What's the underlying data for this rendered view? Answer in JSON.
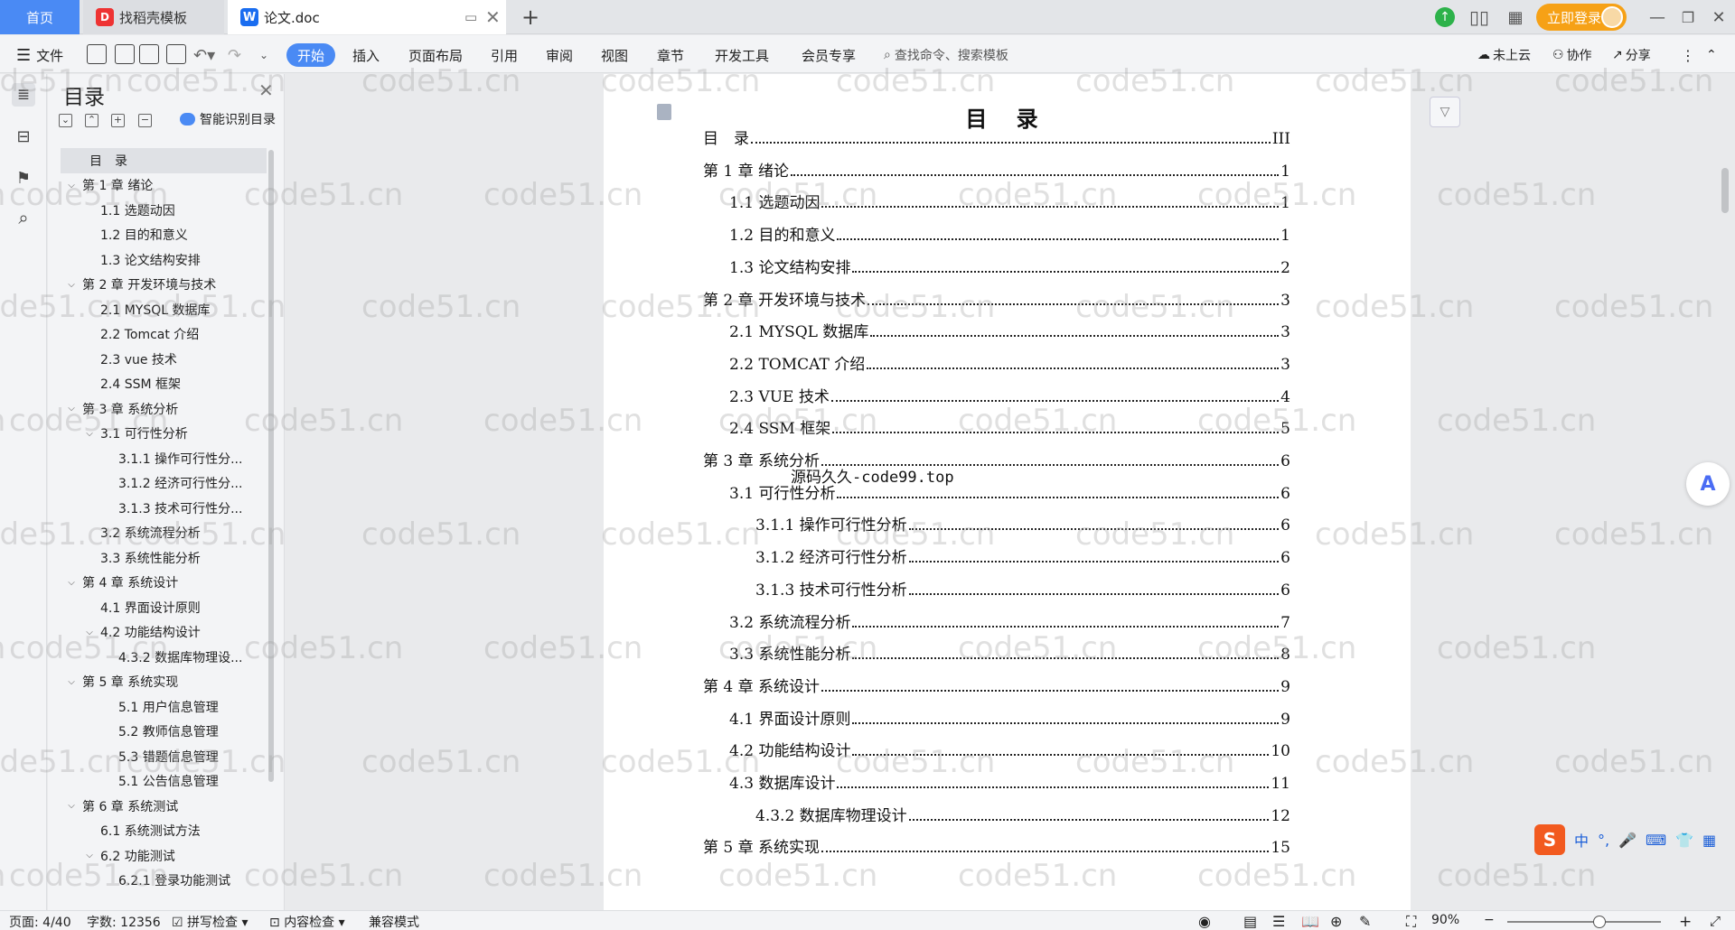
{
  "titlebar": {
    "tabs": [
      {
        "label": "首页"
      },
      {
        "label": "找稻壳模板"
      },
      {
        "label": "论文.doc"
      }
    ],
    "login_label": "立即登录"
  },
  "menubar": {
    "file_label": "文件",
    "items": [
      "开始",
      "插入",
      "页面布局",
      "引用",
      "审阅",
      "视图",
      "章节",
      "开发工具",
      "会员专享"
    ],
    "search_label": "查找命令、搜索模板",
    "cloud_label": "未上云",
    "collab_label": "协作",
    "share_label": "分享"
  },
  "outline": {
    "title": "目录",
    "smart_label": "智能识别目录",
    "items": [
      {
        "label": "目　录",
        "level": 0,
        "arrow": "",
        "selected": true
      },
      {
        "label": "第 1 章  绪论",
        "level": 0,
        "arrow": "v"
      },
      {
        "label": "1.1 选题动因",
        "level": 1,
        "arrow": ""
      },
      {
        "label": "1.2 目的和意义",
        "level": 1,
        "arrow": ""
      },
      {
        "label": "1.3 论文结构安排",
        "level": 1,
        "arrow": ""
      },
      {
        "label": "第 2 章  开发环境与技术",
        "level": 0,
        "arrow": "v"
      },
      {
        "label": "2.1 MYSQL 数据库",
        "level": 1,
        "arrow": ""
      },
      {
        "label": "2.2 Tomcat  介绍",
        "level": 1,
        "arrow": ""
      },
      {
        "label": "2.3 vue 技术",
        "level": 1,
        "arrow": ""
      },
      {
        "label": "2.4 SSM 框架",
        "level": 1,
        "arrow": ""
      },
      {
        "label": "第 3 章  系统分析",
        "level": 0,
        "arrow": "v"
      },
      {
        "label": "3.1 可行性分析",
        "level": 1,
        "arrow": "v"
      },
      {
        "label": "3.1.1 操作可行性分...",
        "level": 2,
        "arrow": ""
      },
      {
        "label": "3.1.2 经济可行性分...",
        "level": 2,
        "arrow": ""
      },
      {
        "label": "3.1.3 技术可行性分...",
        "level": 2,
        "arrow": ""
      },
      {
        "label": "3.2 系统流程分析",
        "level": 1,
        "arrow": ""
      },
      {
        "label": "3.3 系统性能分析",
        "level": 1,
        "arrow": ""
      },
      {
        "label": "第 4 章  系统设计",
        "level": 0,
        "arrow": "v"
      },
      {
        "label": "4.1 界面设计原则",
        "level": 1,
        "arrow": ""
      },
      {
        "label": "4.2 功能结构设计",
        "level": 1,
        "arrow": "v"
      },
      {
        "label": "4.3.2  数据库物理设...",
        "level": 2,
        "arrow": ""
      },
      {
        "label": "第 5 章  系统实现",
        "level": 0,
        "arrow": "v"
      },
      {
        "label": "5.1 用户信息管理",
        "level": 2,
        "arrow": ""
      },
      {
        "label": "5.2  教师信息管理",
        "level": 2,
        "arrow": ""
      },
      {
        "label": "5.3 错题信息管理",
        "level": 2,
        "arrow": ""
      },
      {
        "label": "5.1 公告信息管理",
        "level": 2,
        "arrow": ""
      },
      {
        "label": "第 6 章  系统测试",
        "level": 0,
        "arrow": "v"
      },
      {
        "label": "6.1  系统测试方法",
        "level": 1,
        "arrow": ""
      },
      {
        "label": "6.2  功能测试",
        "level": 1,
        "arrow": "v"
      },
      {
        "label": "6.2.1  登录功能测试",
        "level": 2,
        "arrow": ""
      }
    ]
  },
  "document": {
    "title": "目 录",
    "toc": [
      {
        "text": "目　录",
        "page": "III",
        "indent": 0
      },
      {
        "text": "第 1 章  绪论",
        "page": "1",
        "indent": 0
      },
      {
        "text": "1.1 选题动因",
        "page": "1",
        "indent": 1
      },
      {
        "text": "1.2 目的和意义",
        "page": "1",
        "indent": 1
      },
      {
        "text": "1.3 论文结构安排",
        "page": "2",
        "indent": 1
      },
      {
        "text": "第 2 章  开发环境与技术",
        "page": "3",
        "indent": 0
      },
      {
        "text": "2.1 MYSQL 数据库",
        "page": "3",
        "indent": 1
      },
      {
        "text": "2.2 TOMCAT  介绍",
        "page": "3",
        "indent": 1
      },
      {
        "text": "2.3 VUE 技术",
        "page": "4",
        "indent": 1
      },
      {
        "text": "2.4 SSM 框架",
        "page": "5",
        "indent": 1
      },
      {
        "text": "第 3 章  系统分析",
        "page": "6",
        "indent": 0
      },
      {
        "text": "3.1 可行性分析",
        "page": "6",
        "indent": 1
      },
      {
        "text": "3.1.1 操作可行性分析",
        "page": "6",
        "indent": 2
      },
      {
        "text": "3.1.2 经济可行性分析",
        "page": "6",
        "indent": 2
      },
      {
        "text": "3.1.3 技术可行性分析",
        "page": "6",
        "indent": 2
      },
      {
        "text": "3.2 系统流程分析",
        "page": "7",
        "indent": 1
      },
      {
        "text": "3.3 系统性能分析",
        "page": "8",
        "indent": 1
      },
      {
        "text": "第 4 章  系统设计",
        "page": "9",
        "indent": 0
      },
      {
        "text": "4.1 界面设计原则",
        "page": "9",
        "indent": 1
      },
      {
        "text": "4.2 功能结构设计",
        "page": "10",
        "indent": 1
      },
      {
        "text": "4.3 数据库设计",
        "page": "11",
        "indent": 1
      },
      {
        "text": "4.3.2  数据库物理设计",
        "page": "12",
        "indent": 2
      },
      {
        "text": "第 5 章  系统实现",
        "page": "15",
        "indent": 0
      }
    ],
    "overlay_text": "源码久久-code99.top"
  },
  "watermark_text": "code51.cn",
  "statusbar": {
    "page": "页面: 4/40",
    "words": "字数: 12356",
    "spell": "拼写检查",
    "content": "内容检查",
    "compat": "兼容模式",
    "zoom": "90%",
    "zoom_level": 0.6
  },
  "ime": {
    "label": "中"
  },
  "colors": {
    "accent": "#4a8af4",
    "login": "#f6a116"
  }
}
